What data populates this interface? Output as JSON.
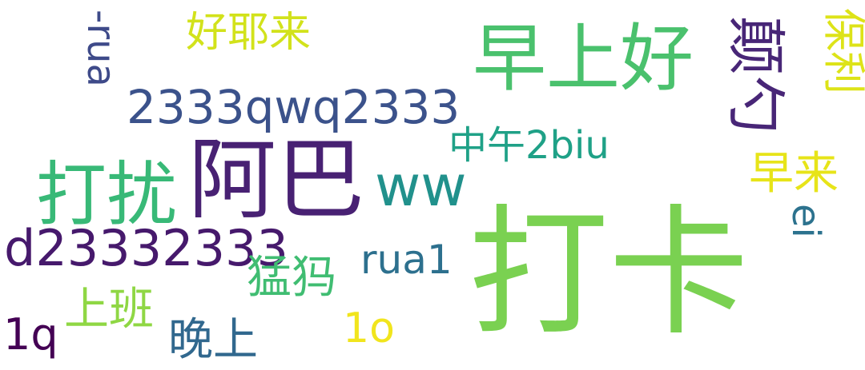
{
  "words": [
    {
      "text": "打卡",
      "color": "#7ad151",
      "orientation": "horizontal"
    },
    {
      "text": "早上好",
      "color": "#4ac16d",
      "orientation": "horizontal"
    },
    {
      "text": "阿巴",
      "color": "#482173",
      "orientation": "horizontal"
    },
    {
      "text": "打扰",
      "color": "#38b977",
      "orientation": "horizontal"
    },
    {
      "text": "ww",
      "color": "#21918c",
      "orientation": "horizontal"
    },
    {
      "text": "2333qwq2333",
      "color": "#3b528b",
      "orientation": "horizontal"
    },
    {
      "text": "d23332333",
      "color": "#46196c",
      "orientation": "horizontal"
    },
    {
      "text": "颠勺",
      "color": "#482677",
      "orientation": "vertical"
    },
    {
      "text": "中午2biu",
      "color": "#1fa187",
      "orientation": "horizontal"
    },
    {
      "text": "好耶来",
      "color": "#d2e21b",
      "orientation": "horizontal"
    },
    {
      "text": "-rua",
      "color": "#3e4a89",
      "orientation": "vertical"
    },
    {
      "text": "保利",
      "color": "#dde318",
      "orientation": "vertical"
    },
    {
      "text": "早来",
      "color": "#e7e419",
      "orientation": "horizontal"
    },
    {
      "text": "ei",
      "color": "#2c728e",
      "orientation": "vertical"
    },
    {
      "text": "rua1",
      "color": "#2d708e",
      "orientation": "horizontal"
    },
    {
      "text": "猛犸",
      "color": "#40bd72",
      "orientation": "horizontal"
    },
    {
      "text": "上班",
      "color": "#8fd744",
      "orientation": "horizontal"
    },
    {
      "text": "1q",
      "color": "#440154",
      "orientation": "horizontal"
    },
    {
      "text": "晚上",
      "color": "#31688e",
      "orientation": "horizontal"
    },
    {
      "text": "1o",
      "color": "#f1e51d",
      "orientation": "horizontal"
    }
  ]
}
